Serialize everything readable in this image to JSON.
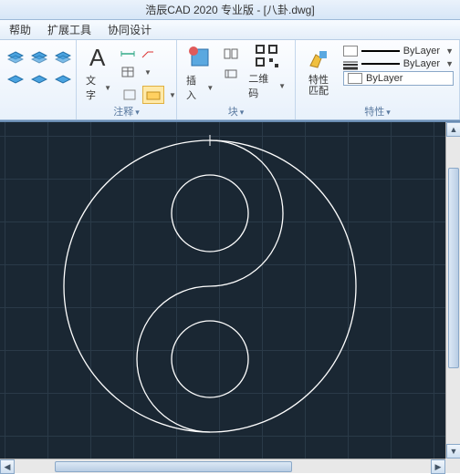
{
  "title": "浩辰CAD 2020 专业版 - [八卦.dwg]",
  "menu": {
    "help": "帮助",
    "ext": "扩展工具",
    "collab": "协同设计"
  },
  "ribbon": {
    "annot": {
      "text_label": "文字",
      "group_label": "注释"
    },
    "block": {
      "insert_label": "插入",
      "qr_label": "二维码",
      "group_label": "块"
    },
    "props": {
      "match_label": "特性\n匹配",
      "group_label": "特性",
      "bylayer": "ByLayer",
      "bylayer2": "ByLayer"
    },
    "layer_combo": "ByLayer"
  },
  "colors": {
    "canvas_bg": "#1a2733",
    "grid": "#2a3a48",
    "stroke": "#ffffff"
  }
}
